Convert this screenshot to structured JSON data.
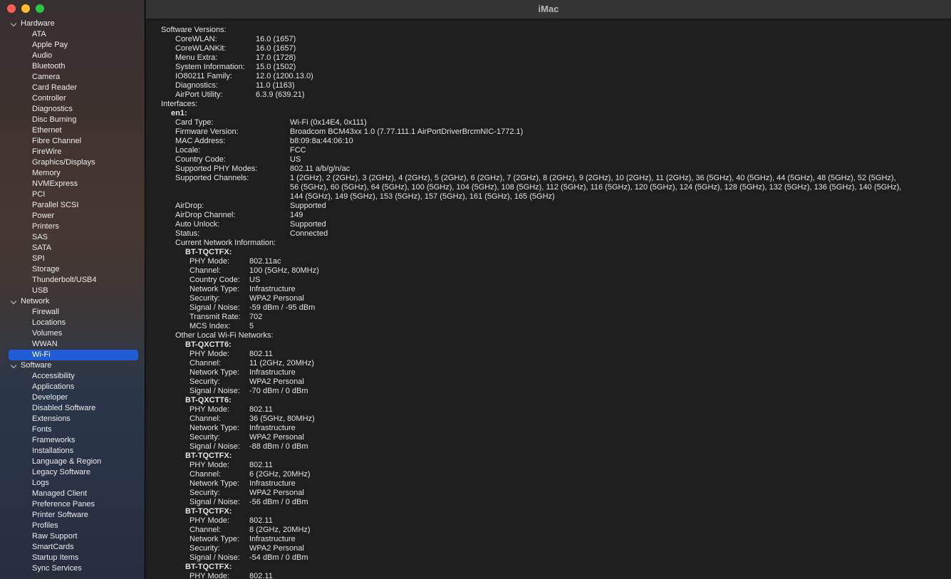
{
  "window": {
    "title": "iMac"
  },
  "sidebar": {
    "groups": [
      {
        "label": "Hardware",
        "items": [
          "ATA",
          "Apple Pay",
          "Audio",
          "Bluetooth",
          "Camera",
          "Card Reader",
          "Controller",
          "Diagnostics",
          "Disc Burning",
          "Ethernet",
          "Fibre Channel",
          "FireWire",
          "Graphics/Displays",
          "Memory",
          "NVMExpress",
          "PCI",
          "Parallel SCSI",
          "Power",
          "Printers",
          "SAS",
          "SATA",
          "SPI",
          "Storage",
          "Thunderbolt/USB4",
          "USB"
        ]
      },
      {
        "label": "Network",
        "items": [
          "Firewall",
          "Locations",
          "Volumes",
          "WWAN",
          "Wi-Fi"
        ]
      },
      {
        "label": "Software",
        "items": [
          "Accessibility",
          "Applications",
          "Developer",
          "Disabled Software",
          "Extensions",
          "Fonts",
          "Frameworks",
          "Installations",
          "Language & Region",
          "Legacy Software",
          "Logs",
          "Managed Client",
          "Preference Panes",
          "Printer Software",
          "Profiles",
          "Raw Support",
          "SmartCards",
          "Startup Items",
          "Sync Services"
        ]
      }
    ],
    "selected": "Wi-Fi"
  },
  "content": {
    "software_versions_label": "Software Versions:",
    "software_versions": [
      {
        "k": "CoreWLAN:",
        "v": "16.0 (1657)"
      },
      {
        "k": "CoreWLANKit:",
        "v": "16.0 (1657)"
      },
      {
        "k": "Menu Extra:",
        "v": "17.0 (1728)"
      },
      {
        "k": "System Information:",
        "v": "15.0 (1502)"
      },
      {
        "k": "IO80211 Family:",
        "v": "12.0 (1200.13.0)"
      },
      {
        "k": "Diagnostics:",
        "v": "11.0 (1163)"
      },
      {
        "k": "AirPort Utility:",
        "v": "6.3.9 (639.21)"
      }
    ],
    "interfaces_label": "Interfaces:",
    "interface_name": "en1:",
    "interface_props": [
      {
        "k": "Card Type:",
        "v": "Wi-Fi  (0x14E4, 0x111)"
      },
      {
        "k": "Firmware Version:",
        "v": "Broadcom BCM43xx 1.0 (7.77.111.1 AirPortDriverBrcmNIC-1772.1)"
      },
      {
        "k": "MAC Address:",
        "v": "b8:09:8a:44:06:10"
      },
      {
        "k": "Locale:",
        "v": "FCC"
      },
      {
        "k": "Country Code:",
        "v": "US"
      },
      {
        "k": "Supported PHY Modes:",
        "v": "802.11 a/b/g/n/ac"
      },
      {
        "k": "Supported Channels:",
        "v": "1 (2GHz), 2 (2GHz), 3 (2GHz), 4 (2GHz), 5 (2GHz), 6 (2GHz), 7 (2GHz), 8 (2GHz), 9 (2GHz), 10 (2GHz), 11 (2GHz), 36 (5GHz), 40 (5GHz), 44 (5GHz), 48 (5GHz), 52 (5GHz),",
        "v2": "56 (5GHz), 60 (5GHz), 64 (5GHz), 100 (5GHz), 104 (5GHz), 108 (5GHz), 112 (5GHz), 116 (5GHz), 120 (5GHz), 124 (5GHz), 128 (5GHz), 132 (5GHz), 136 (5GHz), 140 (5GHz),",
        "v3": "144 (5GHz), 149 (5GHz), 153 (5GHz), 157 (5GHz), 161 (5GHz), 165 (5GHz)"
      },
      {
        "k": "AirDrop:",
        "v": "Supported"
      },
      {
        "k": "AirDrop Channel:",
        "v": "149"
      },
      {
        "k": "Auto Unlock:",
        "v": "Supported"
      },
      {
        "k": "Status:",
        "v": "Connected"
      }
    ],
    "current_network_label": "Current Network Information:",
    "current_network": {
      "name": "BT-TQCTFX:",
      "props": [
        {
          "k": "PHY Mode:",
          "v": "802.11ac"
        },
        {
          "k": "Channel:",
          "v": "100 (5GHz, 80MHz)"
        },
        {
          "k": "Country Code:",
          "v": "US"
        },
        {
          "k": "Network Type:",
          "v": "Infrastructure"
        },
        {
          "k": "Security:",
          "v": "WPA2 Personal"
        },
        {
          "k": "Signal / Noise:",
          "v": "-59 dBm / -95 dBm"
        },
        {
          "k": "Transmit Rate:",
          "v": "702"
        },
        {
          "k": "MCS Index:",
          "v": "5"
        }
      ]
    },
    "other_networks_label": "Other Local Wi-Fi Networks:",
    "other_networks": [
      {
        "name": "BT-QXCTT6:",
        "props": [
          {
            "k": "PHY Mode:",
            "v": "802.11"
          },
          {
            "k": "Channel:",
            "v": "11 (2GHz, 20MHz)"
          },
          {
            "k": "Network Type:",
            "v": "Infrastructure"
          },
          {
            "k": "Security:",
            "v": "WPA2 Personal"
          },
          {
            "k": "Signal / Noise:",
            "v": "-70 dBm / 0 dBm"
          }
        ]
      },
      {
        "name": "BT-QXCTT6:",
        "props": [
          {
            "k": "PHY Mode:",
            "v": "802.11"
          },
          {
            "k": "Channel:",
            "v": "36 (5GHz, 80MHz)"
          },
          {
            "k": "Network Type:",
            "v": "Infrastructure"
          },
          {
            "k": "Security:",
            "v": "WPA2 Personal"
          },
          {
            "k": "Signal / Noise:",
            "v": "-88 dBm / 0 dBm"
          }
        ]
      },
      {
        "name": "BT-TQCTFX:",
        "props": [
          {
            "k": "PHY Mode:",
            "v": "802.11"
          },
          {
            "k": "Channel:",
            "v": "6 (2GHz, 20MHz)"
          },
          {
            "k": "Network Type:",
            "v": "Infrastructure"
          },
          {
            "k": "Security:",
            "v": "WPA2 Personal"
          },
          {
            "k": "Signal / Noise:",
            "v": "-56 dBm / 0 dBm"
          }
        ]
      },
      {
        "name": "BT-TQCTFX:",
        "props": [
          {
            "k": "PHY Mode:",
            "v": "802.11"
          },
          {
            "k": "Channel:",
            "v": "8 (2GHz, 20MHz)"
          },
          {
            "k": "Network Type:",
            "v": "Infrastructure"
          },
          {
            "k": "Security:",
            "v": "WPA2 Personal"
          },
          {
            "k": "Signal / Noise:",
            "v": "-54 dBm / 0 dBm"
          }
        ]
      },
      {
        "name": "BT-TQCTFX:",
        "props": [
          {
            "k": "PHY Mode:",
            "v": "802.11"
          }
        ]
      }
    ]
  }
}
